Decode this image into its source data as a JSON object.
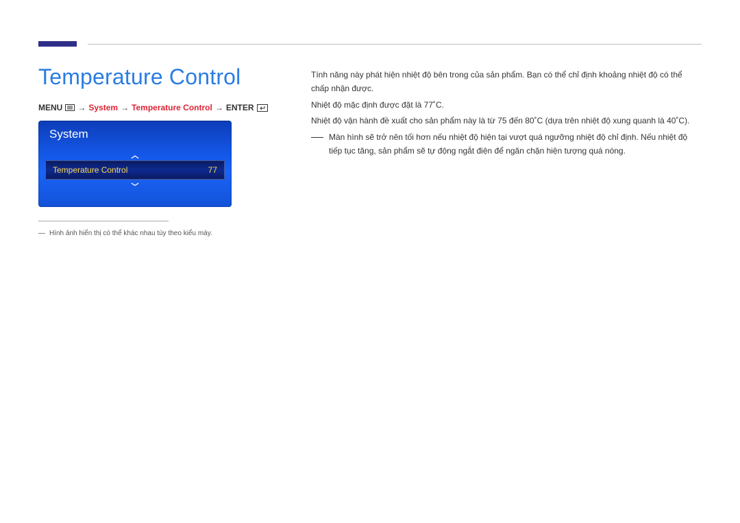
{
  "title": "Temperature Control",
  "breadcrumb": {
    "menu_label": "MENU",
    "arrow": "→",
    "system": "System",
    "temperature_control": "Temperature Control",
    "enter_label": "ENTER"
  },
  "osd": {
    "title": "System",
    "row_label": "Temperature Control",
    "row_value": "77"
  },
  "footnote": {
    "dash": "―",
    "text": "Hình ảnh hiển thị có thể khác nhau tùy theo kiểu máy."
  },
  "body": {
    "p1": "Tính năng này phát hiện nhiệt độ bên trong của sản phẩm. Bạn có thể chỉ định khoảng nhiệt độ có thể chấp nhận được.",
    "p2": "Nhiệt độ mặc định được đặt là 77˚C.",
    "p3": "Nhiệt độ vận hành đề xuất cho sản phẩm này là từ 75 đến 80˚C (dựa trên nhiệt độ xung quanh là 40˚C).",
    "note": "Màn hình sẽ trở nên tối hơn nếu nhiệt độ hiện tại vượt quá ngưỡng nhiệt độ chỉ định. Nếu nhiệt độ tiếp tục tăng, sản phẩm sẽ tự động ngắt điện để ngăn chặn hiện tượng quá nóng."
  }
}
